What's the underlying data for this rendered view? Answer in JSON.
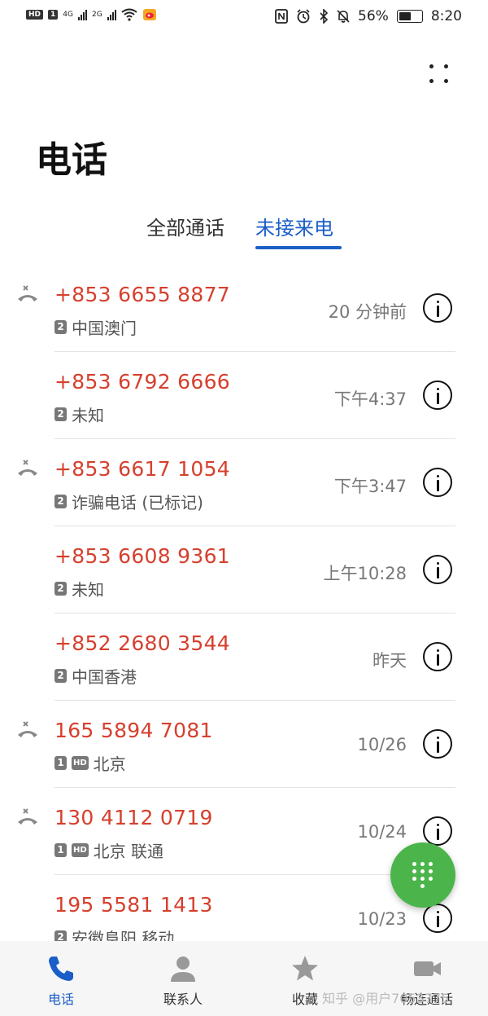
{
  "status_bar": {
    "left_badges": [
      "HD",
      "1",
      "4G",
      "2G"
    ],
    "battery_percent": "56%",
    "time": "8:20"
  },
  "page_title": "电话",
  "tabs": [
    {
      "label": "全部通话",
      "selected": false
    },
    {
      "label": "未接来电",
      "selected": true
    }
  ],
  "calls": [
    {
      "number": "+853 6655 8877",
      "location": "中国澳门",
      "sim": "2",
      "hd": false,
      "time": "20 分钟前",
      "missed_icon": true
    },
    {
      "number": "+853 6792 6666",
      "location": "未知",
      "sim": "2",
      "hd": false,
      "time": "下午4:37",
      "missed_icon": false
    },
    {
      "number": "+853 6617 1054",
      "location": "诈骗电话 (已标记)",
      "sim": "2",
      "hd": false,
      "time": "下午3:47",
      "missed_icon": true
    },
    {
      "number": "+853 6608 9361",
      "location": "未知",
      "sim": "2",
      "hd": false,
      "time": "上午10:28",
      "missed_icon": false
    },
    {
      "number": "+852 2680 3544",
      "location": "中国香港",
      "sim": "2",
      "hd": false,
      "time": "昨天",
      "missed_icon": false
    },
    {
      "number": "165 5894 7081",
      "location": "北京",
      "sim": "1",
      "hd": true,
      "time": "10/26",
      "missed_icon": true
    },
    {
      "number": "130 4112 0719",
      "location": "北京 联通",
      "sim": "1",
      "hd": true,
      "time": "10/24",
      "missed_icon": true
    },
    {
      "number": "195 5581 1413",
      "location": "安徽阜阳 移动",
      "sim": "2",
      "hd": false,
      "time": "10/23",
      "missed_icon": false
    }
  ],
  "bottom_nav": [
    {
      "label": "电话",
      "icon": "phone-icon",
      "selected": true
    },
    {
      "label": "联系人",
      "icon": "contacts-icon",
      "selected": false
    },
    {
      "label": "收藏",
      "icon": "star-icon",
      "selected": false
    },
    {
      "label": "畅连通话",
      "icon": "video-call-icon",
      "selected": false
    }
  ],
  "watermark": "知乎 @用户7053775",
  "colors": {
    "accent": "#1a5fc7",
    "missed": "#d6402e",
    "fab": "#4bb54b"
  }
}
